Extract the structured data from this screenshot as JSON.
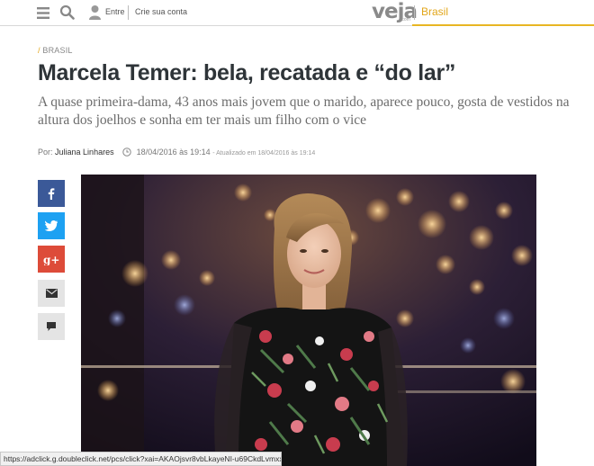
{
  "topbar": {
    "login_label": "Entre",
    "signup_label": "Crie sua conta",
    "logo_text": "veja",
    "logo_suffix": ".com",
    "section_label": "Brasil"
  },
  "article": {
    "section_tag": "BRASIL",
    "headline": "Marcela Temer: bela, recatada e “do lar”",
    "dek": "A quase primeira-dama, 43 anos mais jovem que o marido, aparece pouco, gosta de vestidos na altura dos joelhos e sonha em ter mais um filho com o vice",
    "byline_prefix": "Por:",
    "author": "Juliana Linhares",
    "published": "18/04/2016 às 19:14",
    "updated": "- Atualizado em 18/04/2016 às 19:14"
  },
  "share_buttons": [
    {
      "icon": "facebook-icon",
      "color": "#3b5998"
    },
    {
      "icon": "twitter-icon",
      "color": "#1da1f2"
    },
    {
      "icon": "google-plus-icon",
      "color": "#dd4b39"
    },
    {
      "icon": "mail-icon",
      "color": "#e4e4e4"
    },
    {
      "icon": "comment-icon",
      "color": "#e4e4e4"
    }
  ],
  "colors": {
    "accent": "#e8b623",
    "headline": "#2e3438",
    "dek": "#6c6c6c"
  },
  "status_bar": {
    "url": "https://adclick.g.doubleclick.net/pcs/click?xai=AKAOjsvr8vbLkayeNI-u69CkdLvmxx0u..."
  }
}
